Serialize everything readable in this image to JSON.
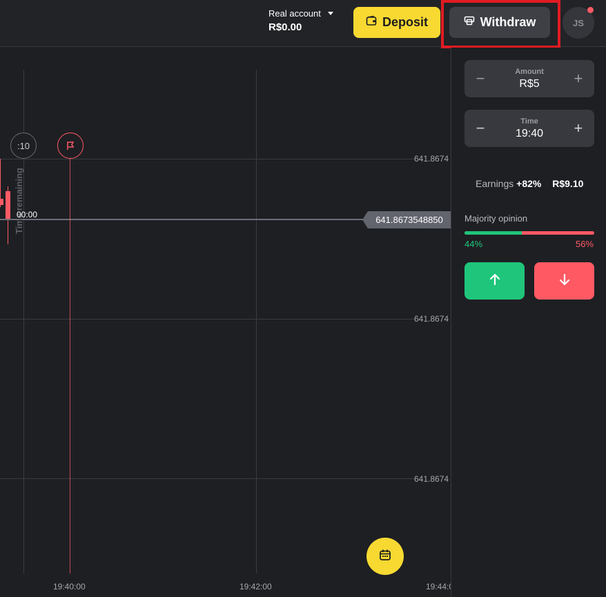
{
  "header": {
    "account_type": "Real account",
    "balance": "R$0.00",
    "deposit_label": "Deposit",
    "withdraw_label": "Withdraw",
    "avatar_initials": "JS",
    "colors": {
      "deposit": "#f8d932",
      "withdraw": "#3f4046",
      "highlight": "#e11b22",
      "notification": "#ff5a64"
    }
  },
  "chart": {
    "y_labels": [
      "641.8674",
      "641.8674",
      "641.8674"
    ],
    "x_labels": [
      "19:40:00",
      "19:42:00",
      "19:44:0"
    ],
    "current_price": "641.8673548850",
    "timer_label": ":10",
    "time_remaining_label": "Time remaining",
    "countdown": "00:00",
    "colors": {
      "down": "#ff5a64",
      "up": "#1fc57a",
      "grid": "#3b3c41"
    }
  },
  "panel": {
    "amount": {
      "label": "Amount",
      "value": "R$5",
      "minus": "−",
      "plus": "+"
    },
    "time": {
      "label": "Time",
      "value": "19:40",
      "minus": "−",
      "plus": "+"
    },
    "earnings": {
      "label": "Earnings",
      "percent": "+82%",
      "amount": "R$9.10"
    },
    "majority": {
      "label": "Majority opinion",
      "up_percent": "44%",
      "down_percent": "56%",
      "up_fraction": 0.44
    }
  }
}
